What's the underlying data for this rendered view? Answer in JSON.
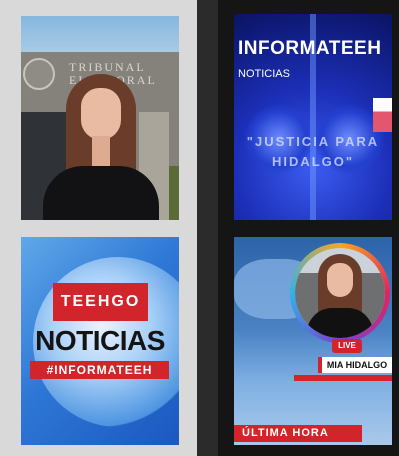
{
  "tiles": [
    {
      "id": "tribunal-anchor",
      "sign_text": "TRIBUNAL ELECTORAL"
    },
    {
      "id": "informateeh-blue",
      "title": "INFORMATEEH",
      "subtitle": "NOTICIAS",
      "quote": "\"JUSTICIA PARA HIDALGO\""
    },
    {
      "id": "teehgo-noticias",
      "brand": "TEEHGO",
      "headline": "NOTICIAS",
      "hashtag": "#INFORMATEEH"
    },
    {
      "id": "live-anchor",
      "live_badge": "LIVE",
      "name": "MIA HIDALGO",
      "banner": "ÚLTIMA HORA"
    }
  ],
  "colors": {
    "brand_red": "#d1242b",
    "deep_blue": "#1c2fb8"
  }
}
